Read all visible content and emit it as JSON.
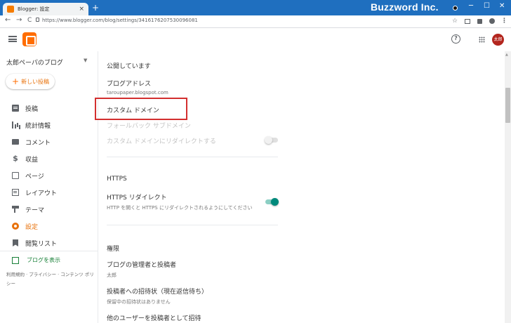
{
  "browser": {
    "tab_title": "Blogger: 設定",
    "tab_close": "×",
    "new_tab": "+",
    "brand": "Buzzword Inc.",
    "minimize": "─",
    "maximize": "☐",
    "close": "✕",
    "back": "←",
    "forward": "→",
    "reload": "C",
    "url": "https://www.blogger.com/blog/settings/3416176207530096081",
    "star": "☆"
  },
  "header": {
    "help_label": "?",
    "avatar_label": "太郎"
  },
  "sidebar": {
    "blog_name": "太郎ペーパのブログ",
    "new_post": "新しい投稿",
    "items": [
      {
        "label": "投稿",
        "icon": "posts-icon",
        "active": false
      },
      {
        "label": "統計情報",
        "icon": "stats-icon",
        "active": false
      },
      {
        "label": "コメント",
        "icon": "comment-icon",
        "active": false
      },
      {
        "label": "収益",
        "icon": "earnings-icon",
        "active": false
      },
      {
        "label": "ページ",
        "icon": "pages-icon",
        "active": false
      },
      {
        "label": "レイアウト",
        "icon": "layout-icon",
        "active": false
      },
      {
        "label": "テーマ",
        "icon": "theme-icon",
        "active": false
      },
      {
        "label": "設定",
        "icon": "settings-icon",
        "active": true
      },
      {
        "label": "閲覧リスト",
        "icon": "reading-list-icon",
        "active": false
      }
    ],
    "view_blog": "ブログを表示",
    "footer": "利用規約 · プライバシー · コンテンツ ポリシー"
  },
  "main": {
    "publishing": {
      "heading": "公開しています",
      "blog_address_label": "ブログアドレス",
      "blog_address_value": "taroupaper.blogspot.com",
      "custom_domain_label": "カスタム ドメイン",
      "fallback_subdomain_label": "フォールバック サブドメイン",
      "redirect_label": "カスタム ドメインにリダイレクトする",
      "redirect_enabled": false
    },
    "https": {
      "heading": "HTTPS",
      "redirect_label": "HTTPS リダイレクト",
      "redirect_desc": "HTTP を開くと HTTPS にリダイレクトされるようにしてください",
      "redirect_enabled": true
    },
    "permissions": {
      "heading": "権限",
      "admins_label": "ブログの管理者と投稿者",
      "admins_value": "太郎",
      "invites_label": "投稿者への招待状（現在返信待ち）",
      "invites_value": "保留中の招待状はありません",
      "invite_more_label": "他のユーザーを投稿者として招待"
    }
  },
  "colors": {
    "accent": "#e8710a",
    "toggle_on": "#00897b",
    "highlight": "#d32f2f",
    "title_bar": "#1f6fbf"
  }
}
